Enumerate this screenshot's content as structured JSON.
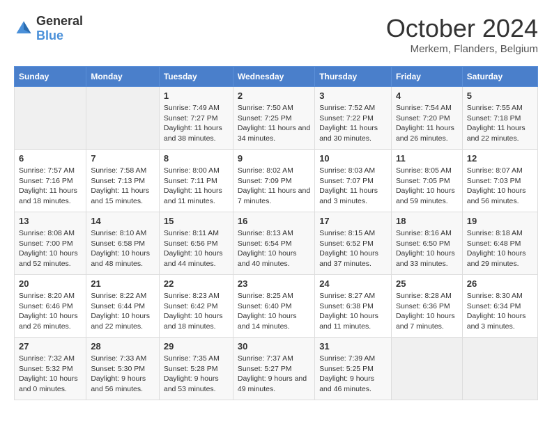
{
  "header": {
    "logo_general": "General",
    "logo_blue": "Blue",
    "month_title": "October 2024",
    "location": "Merkem, Flanders, Belgium"
  },
  "weekdays": [
    "Sunday",
    "Monday",
    "Tuesday",
    "Wednesday",
    "Thursday",
    "Friday",
    "Saturday"
  ],
  "weeks": [
    [
      {
        "day": "",
        "empty": true
      },
      {
        "day": "",
        "empty": true
      },
      {
        "day": "1",
        "sunrise": "7:49 AM",
        "sunset": "7:27 PM",
        "daylight": "11 hours and 38 minutes."
      },
      {
        "day": "2",
        "sunrise": "7:50 AM",
        "sunset": "7:25 PM",
        "daylight": "11 hours and 34 minutes."
      },
      {
        "day": "3",
        "sunrise": "7:52 AM",
        "sunset": "7:22 PM",
        "daylight": "11 hours and 30 minutes."
      },
      {
        "day": "4",
        "sunrise": "7:54 AM",
        "sunset": "7:20 PM",
        "daylight": "11 hours and 26 minutes."
      },
      {
        "day": "5",
        "sunrise": "7:55 AM",
        "sunset": "7:18 PM",
        "daylight": "11 hours and 22 minutes."
      }
    ],
    [
      {
        "day": "6",
        "sunrise": "7:57 AM",
        "sunset": "7:16 PM",
        "daylight": "11 hours and 18 minutes."
      },
      {
        "day": "7",
        "sunrise": "7:58 AM",
        "sunset": "7:13 PM",
        "daylight": "11 hours and 15 minutes."
      },
      {
        "day": "8",
        "sunrise": "8:00 AM",
        "sunset": "7:11 PM",
        "daylight": "11 hours and 11 minutes."
      },
      {
        "day": "9",
        "sunrise": "8:02 AM",
        "sunset": "7:09 PM",
        "daylight": "11 hours and 7 minutes."
      },
      {
        "day": "10",
        "sunrise": "8:03 AM",
        "sunset": "7:07 PM",
        "daylight": "11 hours and 3 minutes."
      },
      {
        "day": "11",
        "sunrise": "8:05 AM",
        "sunset": "7:05 PM",
        "daylight": "10 hours and 59 minutes."
      },
      {
        "day": "12",
        "sunrise": "8:07 AM",
        "sunset": "7:03 PM",
        "daylight": "10 hours and 56 minutes."
      }
    ],
    [
      {
        "day": "13",
        "sunrise": "8:08 AM",
        "sunset": "7:00 PM",
        "daylight": "10 hours and 52 minutes."
      },
      {
        "day": "14",
        "sunrise": "8:10 AM",
        "sunset": "6:58 PM",
        "daylight": "10 hours and 48 minutes."
      },
      {
        "day": "15",
        "sunrise": "8:11 AM",
        "sunset": "6:56 PM",
        "daylight": "10 hours and 44 minutes."
      },
      {
        "day": "16",
        "sunrise": "8:13 AM",
        "sunset": "6:54 PM",
        "daylight": "10 hours and 40 minutes."
      },
      {
        "day": "17",
        "sunrise": "8:15 AM",
        "sunset": "6:52 PM",
        "daylight": "10 hours and 37 minutes."
      },
      {
        "day": "18",
        "sunrise": "8:16 AM",
        "sunset": "6:50 PM",
        "daylight": "10 hours and 33 minutes."
      },
      {
        "day": "19",
        "sunrise": "8:18 AM",
        "sunset": "6:48 PM",
        "daylight": "10 hours and 29 minutes."
      }
    ],
    [
      {
        "day": "20",
        "sunrise": "8:20 AM",
        "sunset": "6:46 PM",
        "daylight": "10 hours and 26 minutes."
      },
      {
        "day": "21",
        "sunrise": "8:22 AM",
        "sunset": "6:44 PM",
        "daylight": "10 hours and 22 minutes."
      },
      {
        "day": "22",
        "sunrise": "8:23 AM",
        "sunset": "6:42 PM",
        "daylight": "10 hours and 18 minutes."
      },
      {
        "day": "23",
        "sunrise": "8:25 AM",
        "sunset": "6:40 PM",
        "daylight": "10 hours and 14 minutes."
      },
      {
        "day": "24",
        "sunrise": "8:27 AM",
        "sunset": "6:38 PM",
        "daylight": "10 hours and 11 minutes."
      },
      {
        "day": "25",
        "sunrise": "8:28 AM",
        "sunset": "6:36 PM",
        "daylight": "10 hours and 7 minutes."
      },
      {
        "day": "26",
        "sunrise": "8:30 AM",
        "sunset": "6:34 PM",
        "daylight": "10 hours and 3 minutes."
      }
    ],
    [
      {
        "day": "27",
        "sunrise": "7:32 AM",
        "sunset": "5:32 PM",
        "daylight": "10 hours and 0 minutes."
      },
      {
        "day": "28",
        "sunrise": "7:33 AM",
        "sunset": "5:30 PM",
        "daylight": "9 hours and 56 minutes."
      },
      {
        "day": "29",
        "sunrise": "7:35 AM",
        "sunset": "5:28 PM",
        "daylight": "9 hours and 53 minutes."
      },
      {
        "day": "30",
        "sunrise": "7:37 AM",
        "sunset": "5:27 PM",
        "daylight": "9 hours and 49 minutes."
      },
      {
        "day": "31",
        "sunrise": "7:39 AM",
        "sunset": "5:25 PM",
        "daylight": "9 hours and 46 minutes."
      },
      {
        "day": "",
        "empty": true
      },
      {
        "day": "",
        "empty": true
      }
    ]
  ]
}
